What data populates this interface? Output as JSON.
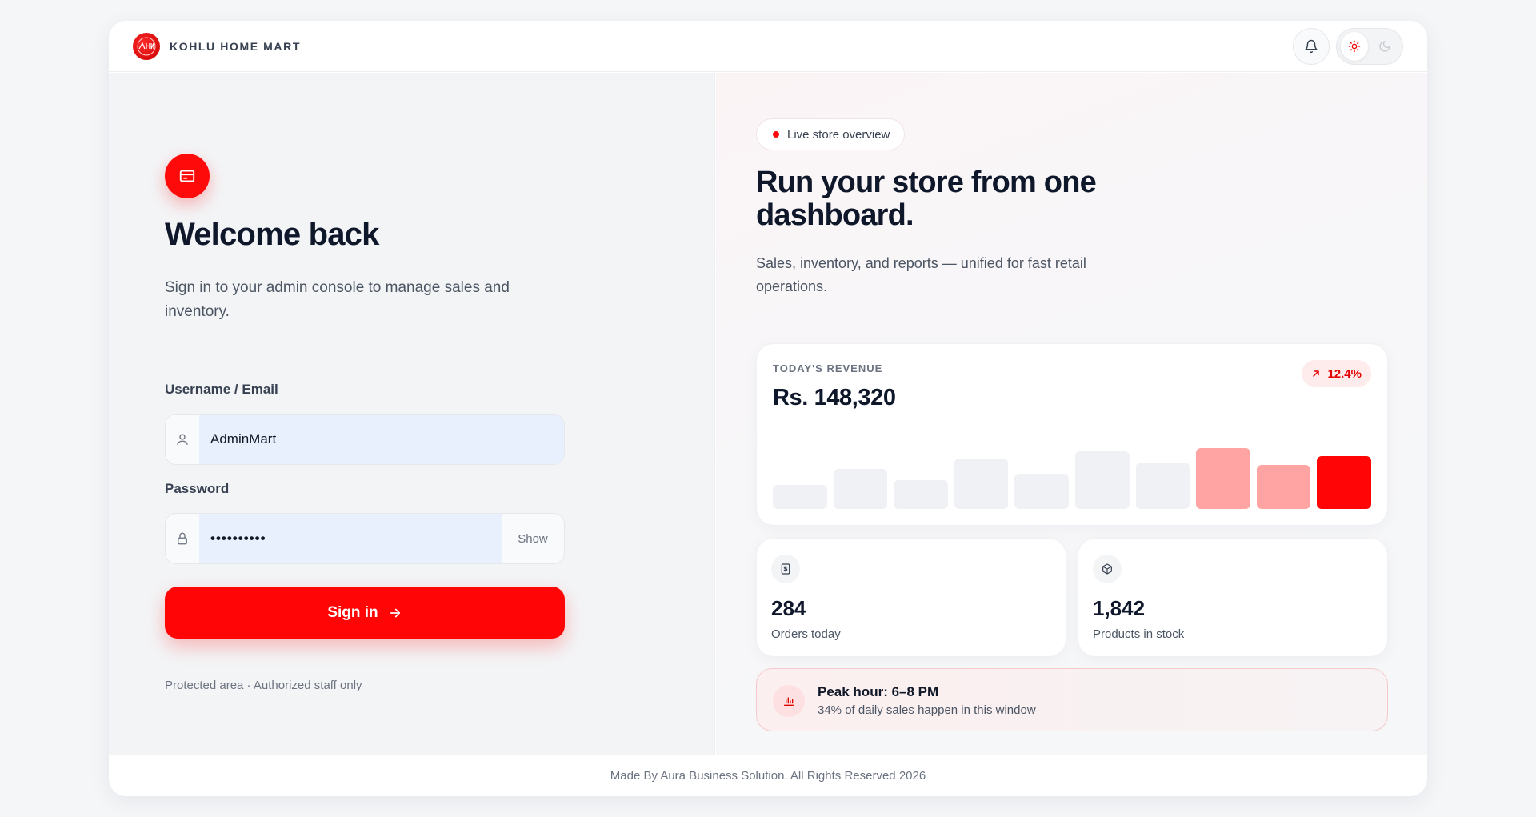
{
  "header": {
    "brand": "KOHLU HOME MART",
    "logo_text": "KHM",
    "notifications_icon": "bell-icon",
    "theme_light_icon": "sun-icon",
    "theme_dark_icon": "moon-icon",
    "theme_selected": "light"
  },
  "login": {
    "title": "Welcome back",
    "subtitle": "Sign in to your admin console to manage sales and inventory.",
    "username_label": "Username / Email",
    "username_value": "AdminMart",
    "password_label": "Password",
    "password_value": "••••••••••",
    "show_label": "Show",
    "submit_label": "Sign in",
    "protected_note": "Protected area · Authorized staff only"
  },
  "overview": {
    "pill_label": "Live store overview",
    "headline": "Run your store from one dashboard.",
    "subtitle": "Sales, inventory, and reports — unified for fast retail operations.",
    "revenue_label": "TODAY'S REVENUE",
    "revenue_value": "Rs. 148,320",
    "trend_value": "12.4%",
    "orders_value": "284",
    "orders_label": "Orders today",
    "products_value": "1,842",
    "products_label": "Products in stock",
    "peak_title": "Peak hour: 6–8 PM",
    "peak_sub": "34% of daily sales happen in this window"
  },
  "chart_data": {
    "type": "bar",
    "values": [
      30,
      50,
      36,
      63,
      44,
      72,
      58,
      76,
      55,
      66
    ],
    "highlight_colors": [
      "#f0f1f4",
      "#f0f1f4",
      "#f0f1f4",
      "#f0f1f4",
      "#f0f1f4",
      "#f0f1f4",
      "#f0f1f4",
      "#ffa3a3",
      "#ffa3a3",
      "#ff0505"
    ],
    "ylim": [
      0,
      100
    ]
  },
  "colors": {
    "accent": "#ff0505",
    "accent_soft": "#ffa3a3"
  },
  "footer": {
    "text": "Made By Aura Business Solution. All Rights Reserved 2026"
  }
}
